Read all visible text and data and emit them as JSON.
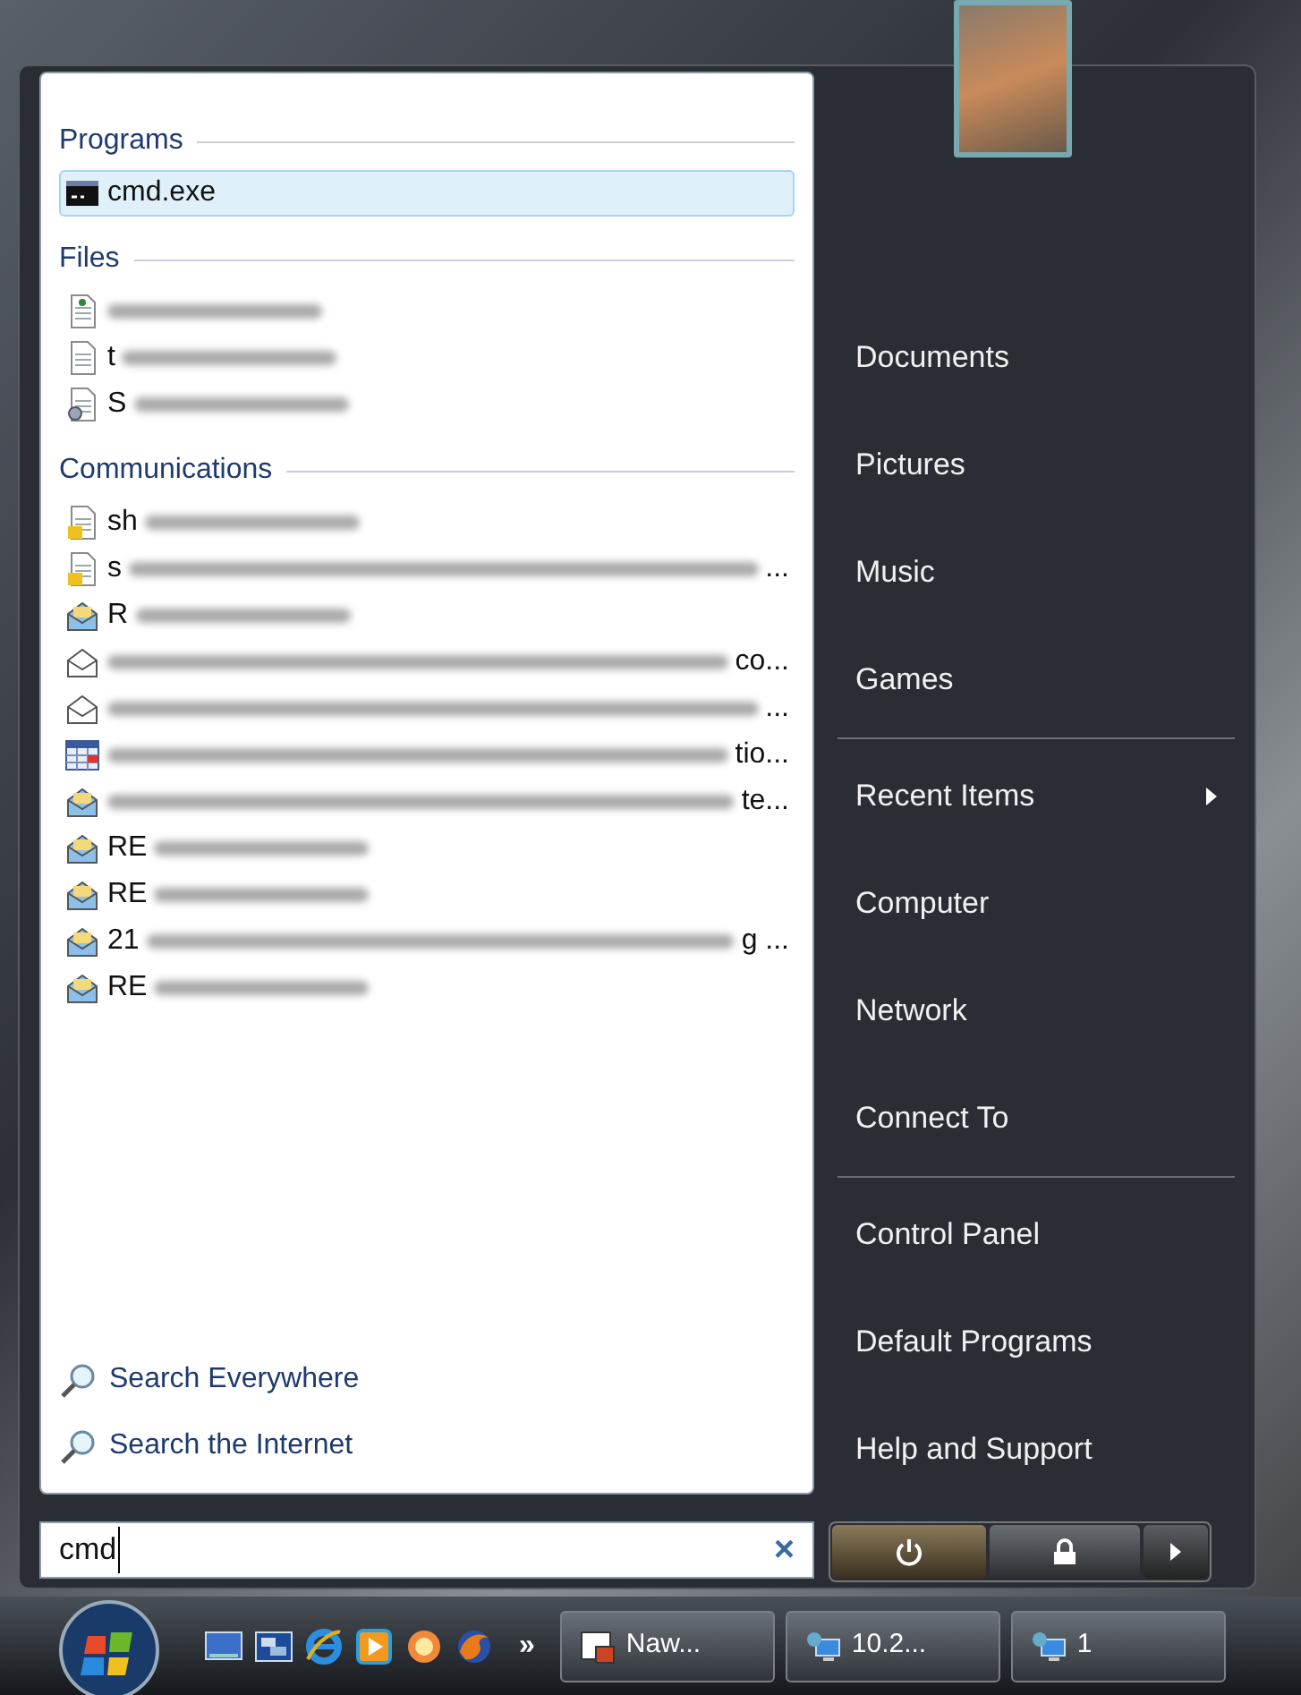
{
  "left_panel": {
    "sections": [
      {
        "title": "Programs",
        "items": [
          {
            "kind": "console",
            "start": "cmd.exe",
            "blurred": false,
            "selected": true
          }
        ]
      },
      {
        "title": "Files",
        "items": [
          {
            "kind": "web-file",
            "blurred": true,
            "selected": false
          },
          {
            "kind": "text-file",
            "start": "t",
            "blurred": true,
            "selected": false
          },
          {
            "kind": "settings-file",
            "start": "S",
            "blurred": true,
            "selected": false
          }
        ]
      },
      {
        "title": "Communications",
        "items": [
          {
            "kind": "note",
            "start": "sh",
            "blurred": true,
            "selected": false
          },
          {
            "kind": "note",
            "start": "s",
            "end": "...",
            "blurred": true,
            "selected": false
          },
          {
            "kind": "mail-open",
            "start": "R",
            "blurred": true,
            "selected": false
          },
          {
            "kind": "mail-closed",
            "end": "co...",
            "blurred": true,
            "selected": false
          },
          {
            "kind": "mail-closed",
            "end": "...",
            "blurred": true,
            "selected": false
          },
          {
            "kind": "calendar",
            "end": "tio...",
            "blurred": true,
            "selected": false
          },
          {
            "kind": "mail-open",
            "end": "te...",
            "blurred": true,
            "selected": false
          },
          {
            "kind": "mail-open",
            "start": "RE",
            "blurred": true,
            "selected": false
          },
          {
            "kind": "mail-open",
            "start": "RE",
            "blurred": true,
            "selected": false
          },
          {
            "kind": "mail-open",
            "start": "21",
            "end": "g ...",
            "blurred": true,
            "selected": false
          },
          {
            "kind": "mail-open",
            "start": "RE",
            "blurred": true,
            "selected": false
          }
        ]
      }
    ],
    "search_links": [
      "Search Everywhere",
      "Search the Internet"
    ]
  },
  "right_panel": {
    "groups": [
      [
        {
          "label": "Documents",
          "submenu": false
        },
        {
          "label": "Pictures",
          "submenu": false
        },
        {
          "label": "Music",
          "submenu": false
        },
        {
          "label": "Games",
          "submenu": false
        }
      ],
      [
        {
          "label": "Recent Items",
          "submenu": true
        },
        {
          "label": "Computer",
          "submenu": false
        },
        {
          "label": "Network",
          "submenu": false
        },
        {
          "label": "Connect To",
          "submenu": false
        }
      ],
      [
        {
          "label": "Control Panel",
          "submenu": false
        },
        {
          "label": "Default Programs",
          "submenu": false
        },
        {
          "label": "Help and Support",
          "submenu": false
        }
      ]
    ]
  },
  "search": {
    "value": "cmd",
    "clear": "×"
  },
  "power_buttons": [
    {
      "kind": "power"
    },
    {
      "kind": "lock"
    },
    {
      "kind": "arrow"
    }
  ],
  "taskbar": {
    "quick_launch": [
      {
        "kind": "desktop"
      },
      {
        "kind": "windows"
      },
      {
        "kind": "browser-e"
      },
      {
        "kind": "media"
      },
      {
        "kind": "messenger"
      },
      {
        "kind": "fox"
      }
    ],
    "more": "»",
    "tasks": [
      {
        "kind": "app",
        "label": "Naw..."
      },
      {
        "kind": "remote",
        "label": "10.2..."
      },
      {
        "kind": "remote",
        "label": "1"
      }
    ]
  }
}
